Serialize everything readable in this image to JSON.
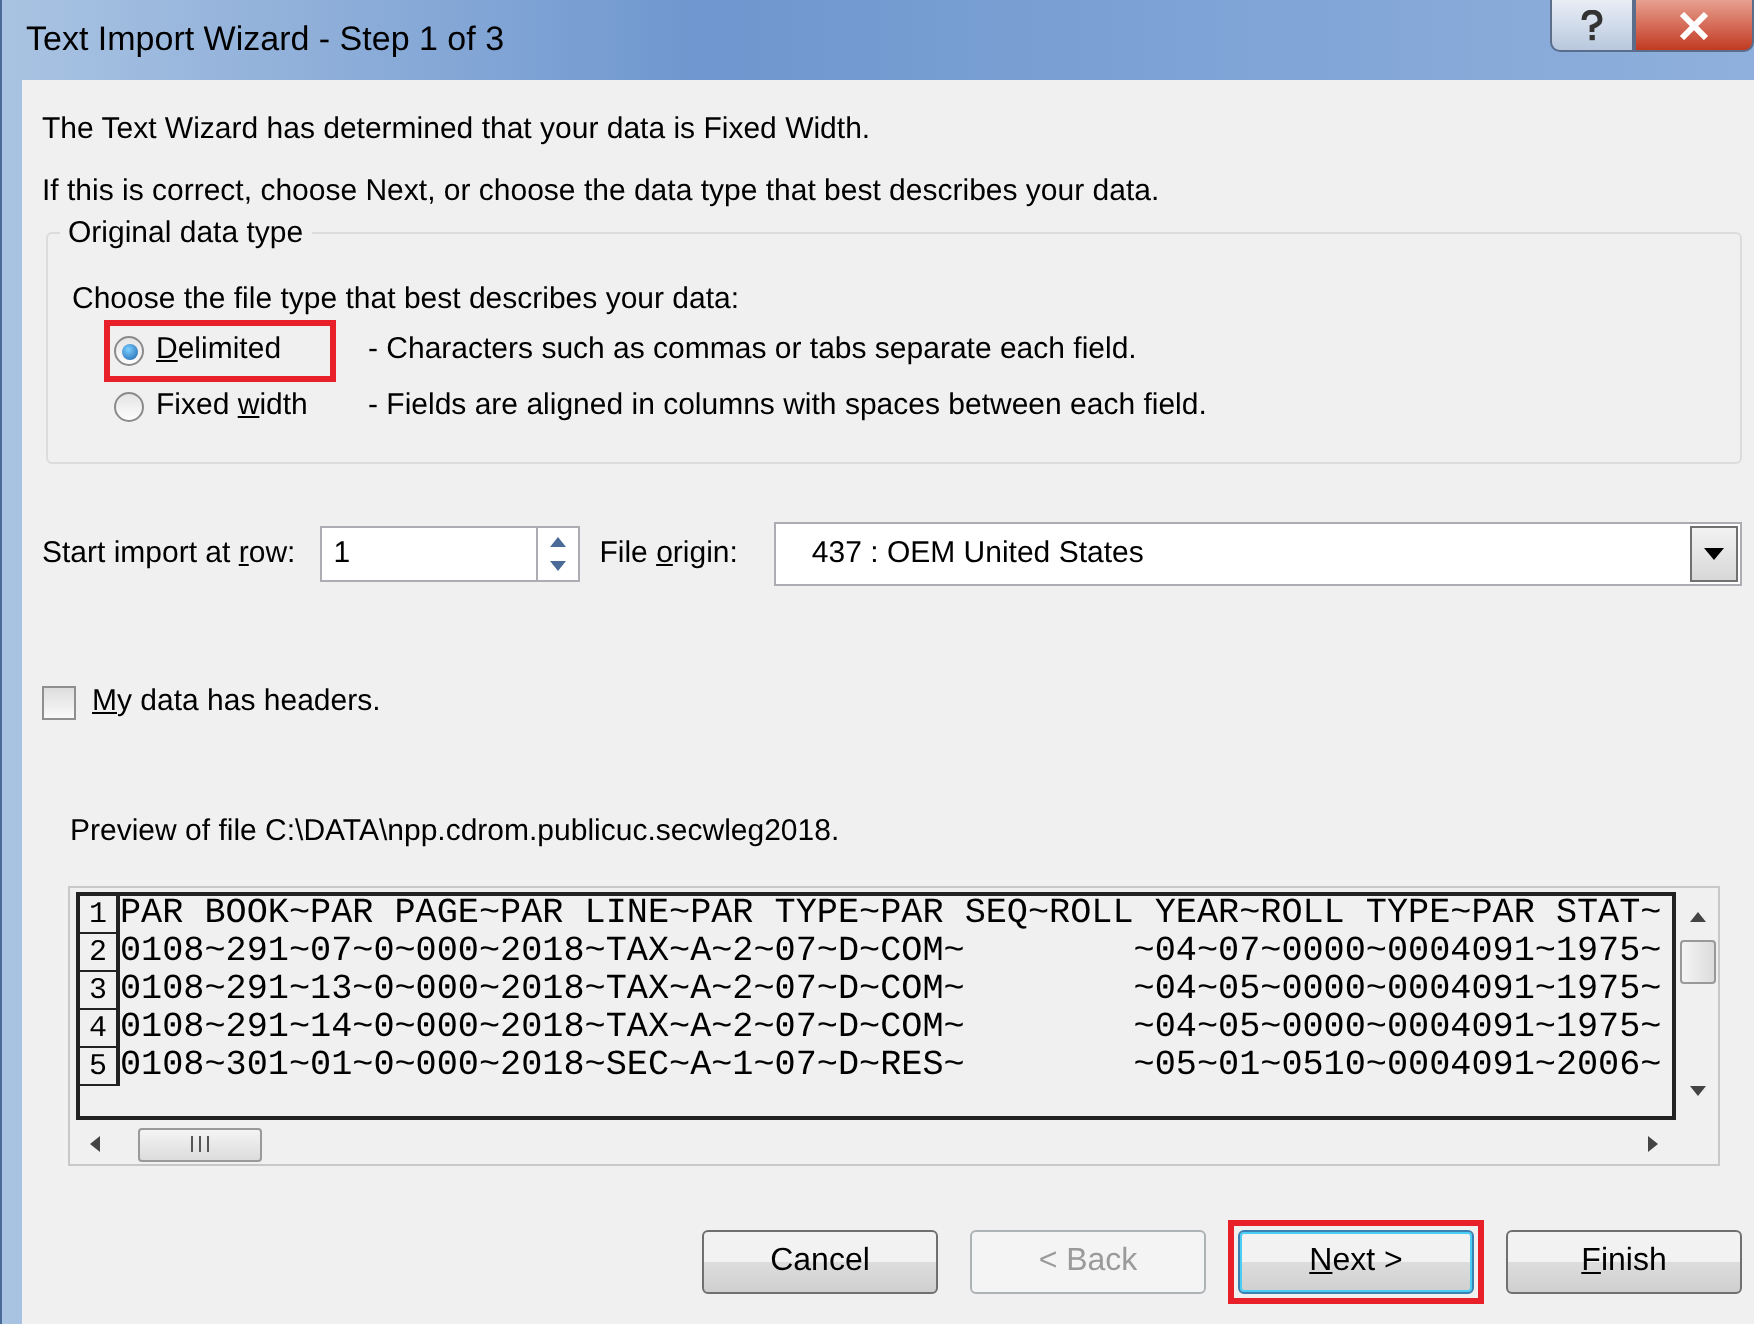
{
  "window": {
    "title": "Text Import Wizard - Step 1 of 3"
  },
  "intro": [
    "The Text Wizard has determined that your data is Fixed Width.",
    "If this is correct, choose Next, or choose the data type that best describes your data."
  ],
  "data_type_group": {
    "legend": "Original data type",
    "prompt": "Choose the file type that best describes your data:",
    "options": [
      {
        "label": {
          "key": "D",
          "after": "elimited"
        },
        "description": "- Characters such as commas or tabs separate each field.",
        "selected": true,
        "highlighted": true
      },
      {
        "label": {
          "before": "Fixed ",
          "key": "w",
          "after": "idth"
        },
        "description": "- Fields are aligned in columns with spaces between each field.",
        "selected": false,
        "highlighted": false
      }
    ]
  },
  "start_row": {
    "label": {
      "before": "Start import at ",
      "key": "r",
      "after": "ow:"
    },
    "value": "1"
  },
  "file_origin": {
    "label": {
      "before": "File ",
      "key": "o",
      "after": "rigin:"
    },
    "value": "437 : OEM United States"
  },
  "headers_checkbox": {
    "label": {
      "key": "M",
      "after": "y data has headers."
    },
    "checked": false
  },
  "preview": {
    "caption": "Preview of file C:\\DATA\\npp.cdrom.publicuc.secwleg2018.",
    "rows": [
      {
        "number": "1",
        "text": "PAR BOOK~PAR PAGE~PAR LINE~PAR TYPE~PAR SEQ~ROLL YEAR~ROLL TYPE~PAR STAT~"
      },
      {
        "number": "2",
        "text": "0108~291~07~0~000~2018~TAX~A~2~07~D~COM~        ~04~07~0000~0004091~1975~"
      },
      {
        "number": "3",
        "text": "0108~291~13~0~000~2018~TAX~A~2~07~D~COM~        ~04~05~0000~0004091~1975~"
      },
      {
        "number": "4",
        "text": "0108~291~14~0~000~2018~TAX~A~2~07~D~COM~        ~04~05~0000~0004091~1975~"
      },
      {
        "number": "5",
        "text": "0108~301~01~0~000~2018~SEC~A~1~07~D~RES~        ~05~01~0510~0004091~2006~"
      }
    ]
  },
  "buttons": [
    {
      "label": {
        "after": "Cancel"
      },
      "disabled": false,
      "default": false,
      "highlighted": false
    },
    {
      "label": {
        "after": "< Back"
      },
      "disabled": true,
      "default": false,
      "highlighted": false
    },
    {
      "label": {
        "key": "N",
        "after": "ext >"
      },
      "disabled": false,
      "default": true,
      "highlighted": true
    },
    {
      "label": {
        "key": "F",
        "after": "inish"
      },
      "disabled": false,
      "default": false,
      "highlighted": false
    }
  ]
}
